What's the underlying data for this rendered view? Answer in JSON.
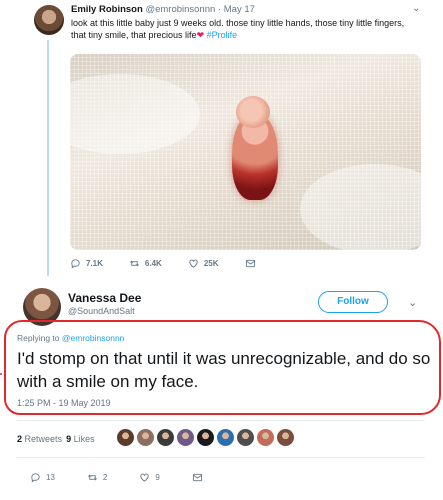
{
  "parent_tweet": {
    "name": "Emily Robinson",
    "handle": "@emrobinsonnn",
    "date": "· May 17",
    "text_pre": "look at this little baby just 9 weeks old. those tiny little hands, those tiny little fingers, that tiny smile, that precious life",
    "heart": "❤",
    "hashtag": "#Prolife",
    "counts": {
      "replies": "7.1K",
      "retweets": "6.4K",
      "likes": "25K"
    },
    "icons": [
      "reply-icon",
      "retweet-icon",
      "like-icon",
      "message-icon"
    ]
  },
  "main_tweet": {
    "name": "Vanessa Dee",
    "handle": "@SoundAndSalt",
    "follow_label": "Follow",
    "replying_to_label": "Replying to",
    "replying_to_handle": "@emrobinsonnn",
    "text": "I'd stomp on that until it was unrecognizable, and do so with a smile on my face.",
    "timestamp": "1:25 PM - 19 May 2019",
    "stats": {
      "retweets_count": "2",
      "retweets_label": "Retweets",
      "likes_count": "9",
      "likes_label": "Likes"
    },
    "action_counts": {
      "replies": "13",
      "retweets": "2",
      "likes": "9"
    }
  },
  "colors": {
    "accent": "#1da1f2",
    "highlight_circle": "#e0282e",
    "heart": "#e0245e",
    "muted": "#657786"
  },
  "liker_colors": [
    "#5a3b2c",
    "#8d6e63",
    "#3b3b3b",
    "#6d5a8a",
    "#1b1b1b",
    "#2b6fb3",
    "#4e4e4e",
    "#c26b5a",
    "#7a4e3a"
  ]
}
